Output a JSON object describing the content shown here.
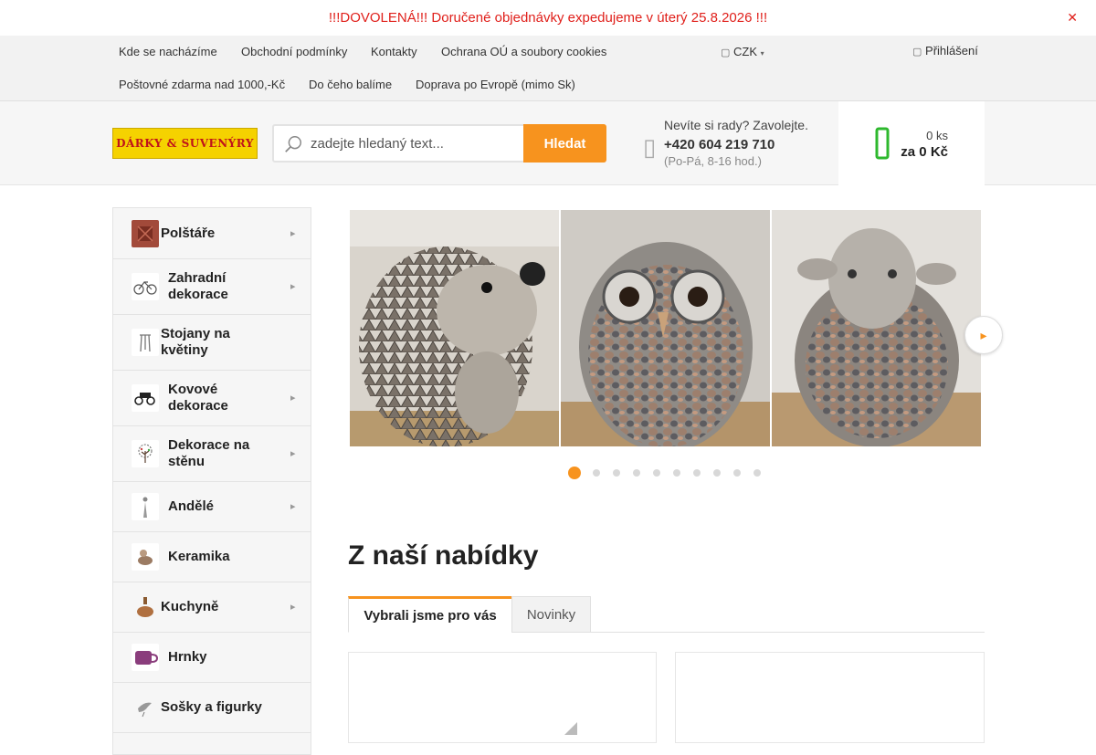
{
  "announcement": {
    "text": "!!!DOVOLENÁ!!! Doručené objednávky expedujeme v úterý 25.8.2026 !!!",
    "close_icon": "close-icon",
    "color": "#e0201b"
  },
  "topnav": {
    "links_row1": [
      "Kde se nacházíme",
      "Obchodní podmínky",
      "Kontakty",
      "Ochrana OÚ a soubory cookies"
    ],
    "links_row2": [
      "Poštovné zdarma nad 1000,-Kč",
      "Do čeho balíme",
      "Doprava po Evropě (mimo Sk)"
    ],
    "currency": "CZK",
    "login": "Přihlášení"
  },
  "header": {
    "logo_text": "DÁRKY & SUVENÝRY",
    "search": {
      "placeholder": "zadejte hledaný text...",
      "button": "Hledat"
    },
    "help": {
      "question": "Nevíte si rady? Zavolejte.",
      "phone": "+420 604 219 710",
      "hours": "(Po-Pá, 8-16 hod.)"
    },
    "cart": {
      "count": "0 ks",
      "total": "za 0 Kč"
    }
  },
  "sidebar": {
    "categories": [
      {
        "label": "Polštáře",
        "has_sub": true
      },
      {
        "label": "Zahradní dekorace",
        "has_sub": true
      },
      {
        "label": "Stojany na květiny",
        "has_sub": false
      },
      {
        "label": "Kovové dekorace",
        "has_sub": true
      },
      {
        "label": "Dekorace na stěnu",
        "has_sub": true
      },
      {
        "label": "Andělé",
        "has_sub": true
      },
      {
        "label": "Keramika",
        "has_sub": false
      },
      {
        "label": "Kuchyně",
        "has_sub": true
      },
      {
        "label": "Hrnky",
        "has_sub": false
      },
      {
        "label": "Sošky a figurky",
        "has_sub": false
      }
    ]
  },
  "carousel": {
    "slides": [
      "hedgehog",
      "owl",
      "sheep"
    ],
    "dots": 10,
    "active_dot": 1
  },
  "section": {
    "title": "Z naší nabídky",
    "tabs": [
      "Vybrali jsme pro vás",
      "Novinky"
    ],
    "active_tab": 0
  },
  "colors": {
    "accent": "#f7931e",
    "cart_green": "#2eb82e"
  }
}
